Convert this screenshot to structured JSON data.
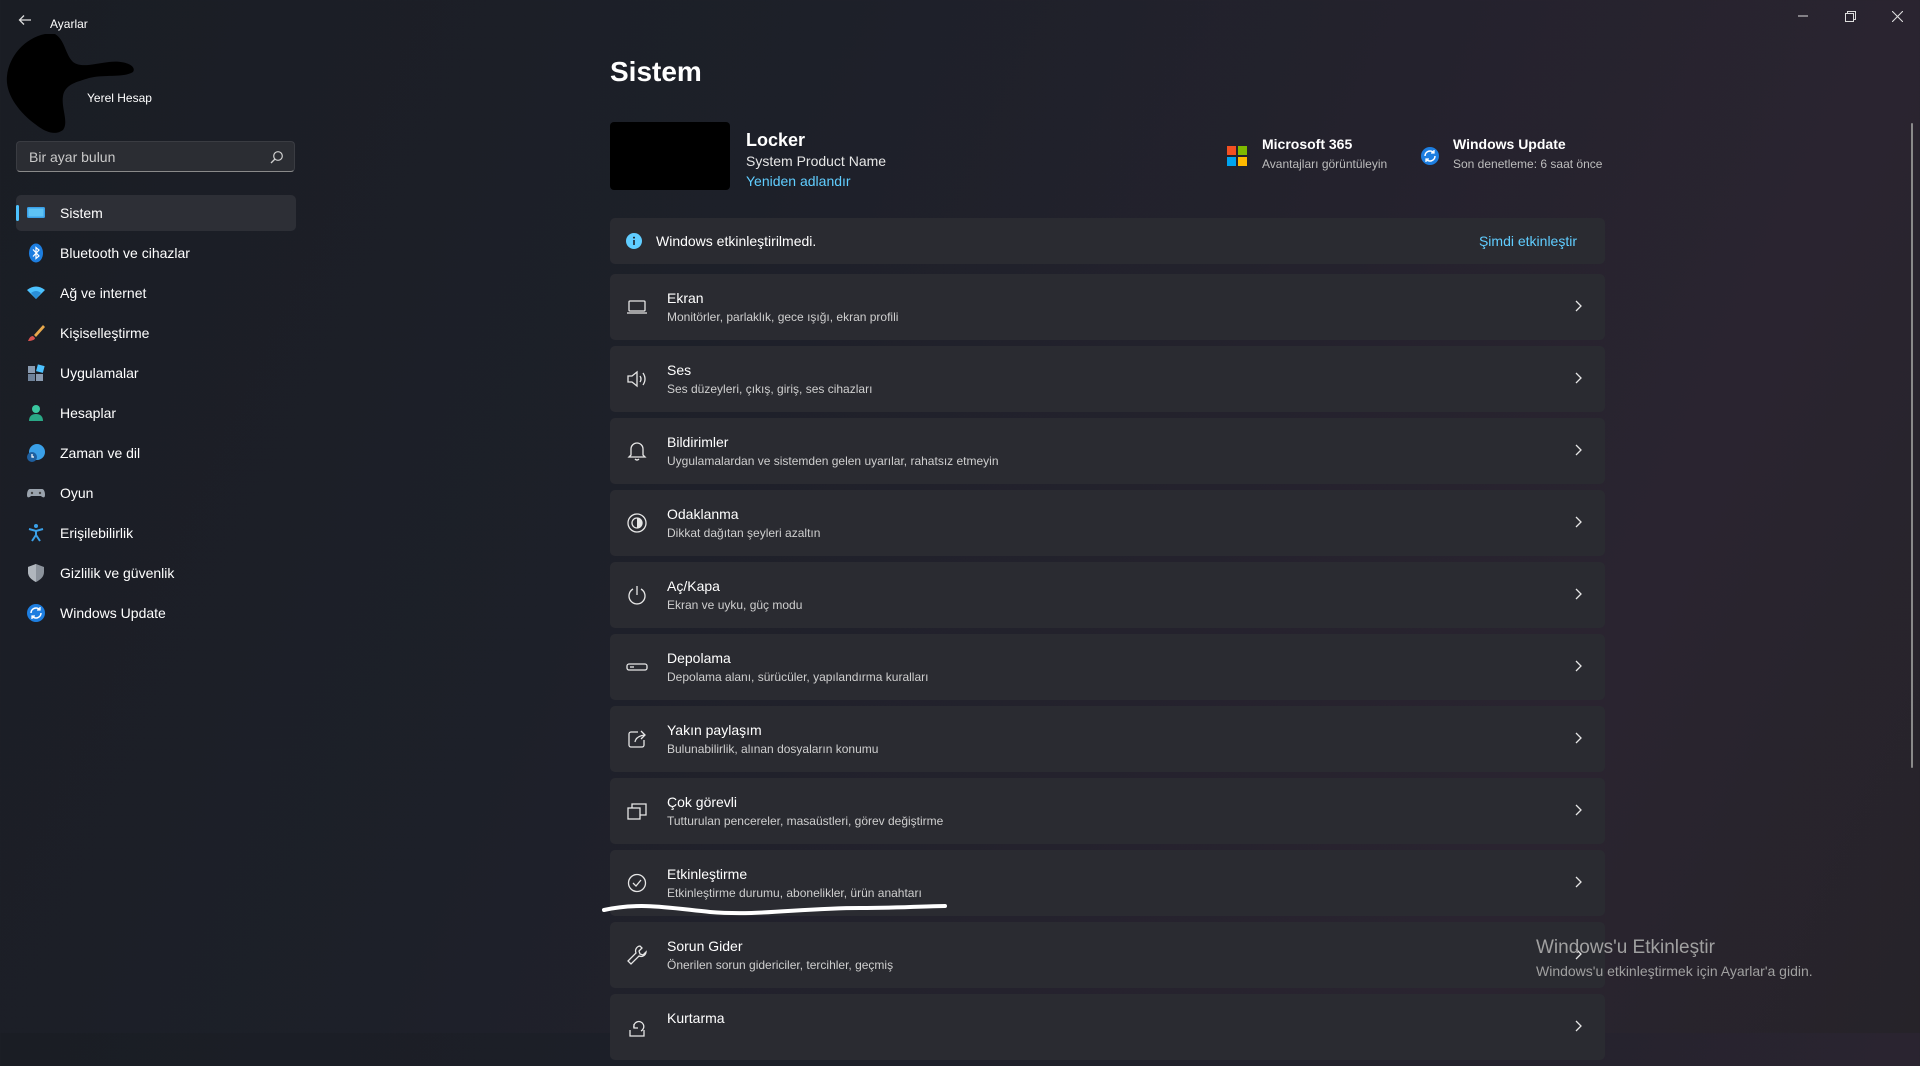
{
  "window": {
    "title": "Ayarlar",
    "back_icon": "arrow-left-icon",
    "minimize_icon": "minimize-icon",
    "restore_icon": "restore-icon",
    "close_icon": "close-icon"
  },
  "account": {
    "name": "Yerel Hesap"
  },
  "search": {
    "placeholder": "Bir ayar bulun",
    "value": ""
  },
  "sidebar": {
    "items": [
      {
        "label": "Sistem",
        "icon": "system-icon",
        "active": true
      },
      {
        "label": "Bluetooth ve cihazlar",
        "icon": "bluetooth-icon"
      },
      {
        "label": "Ağ ve internet",
        "icon": "wifi-icon"
      },
      {
        "label": "Kişiselleştirme",
        "icon": "brush-icon"
      },
      {
        "label": "Uygulamalar",
        "icon": "apps-icon"
      },
      {
        "label": "Hesaplar",
        "icon": "account-icon"
      },
      {
        "label": "Zaman ve dil",
        "icon": "clock-globe-icon"
      },
      {
        "label": "Oyun",
        "icon": "gamepad-icon"
      },
      {
        "label": "Erişilebilirlik",
        "icon": "accessibility-icon"
      },
      {
        "label": "Gizlilik ve güvenlik",
        "icon": "shield-icon"
      },
      {
        "label": "Windows Update",
        "icon": "update-icon"
      }
    ]
  },
  "main": {
    "title": "Sistem",
    "device": {
      "name": "Locker",
      "product": "System Product Name",
      "rename_link": "Yeniden adlandır"
    },
    "header_tiles": [
      {
        "title": "Microsoft 365",
        "subtitle": "Avantajları görüntüleyin",
        "icon": "microsoft-logo-icon"
      },
      {
        "title": "Windows Update",
        "subtitle": "Son denetleme: 6 saat önce",
        "icon": "update-icon"
      }
    ],
    "activation_banner": {
      "text": "Windows etkinleştirilmedi.",
      "link": "Şimdi etkinleştir",
      "icon": "info-icon"
    },
    "settings": [
      {
        "title": "Ekran",
        "subtitle": "Monitörler, parlaklık, gece ışığı, ekran profili",
        "icon": "display-icon"
      },
      {
        "title": "Ses",
        "subtitle": "Ses düzeyleri, çıkış, giriş, ses cihazları",
        "icon": "speaker-icon"
      },
      {
        "title": "Bildirimler",
        "subtitle": "Uygulamalardan ve sistemden gelen uyarılar, rahatsız etmeyin",
        "icon": "bell-icon"
      },
      {
        "title": "Odaklanma",
        "subtitle": "Dikkat dağıtan şeyleri azaltın",
        "icon": "focus-icon"
      },
      {
        "title": "Aç/Kapa",
        "subtitle": "Ekran ve uyku, güç modu",
        "icon": "power-icon"
      },
      {
        "title": "Depolama",
        "subtitle": "Depolama alanı, sürücüler, yapılandırma kuralları",
        "icon": "storage-icon"
      },
      {
        "title": "Yakın paylaşım",
        "subtitle": "Bulunabilirlik, alınan dosyaların konumu",
        "icon": "share-icon"
      },
      {
        "title": "Çok görevli",
        "subtitle": "Tutturulan pencereler, masaüstleri, görev değiştirme",
        "icon": "multitask-icon"
      },
      {
        "title": "Etkinleştirme",
        "subtitle": "Etkinleştirme durumu, abonelikler, ürün anahtarı",
        "icon": "check-circle-icon"
      },
      {
        "title": "Sorun Gider",
        "subtitle": "Önerilen sorun gidericiler, tercihler, geçmiş",
        "icon": "wrench-icon"
      },
      {
        "title": "Kurtarma",
        "subtitle": "",
        "icon": "recovery-icon"
      }
    ]
  },
  "watermark": {
    "title": "Windows'u Etkinleştir",
    "subtitle": "Windows'u etkinleştirmek için Ayarlar'a gidin."
  },
  "colors": {
    "accent": "#60cdff",
    "background": "#1d2029",
    "card": "#2a2b31"
  }
}
